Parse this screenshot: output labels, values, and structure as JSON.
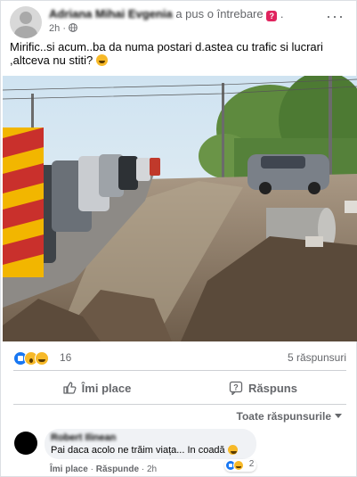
{
  "post": {
    "author": "Adriana Mihai Evgenia",
    "action": "a pus o întrebare",
    "question_icon": "?",
    "time": "2h",
    "separator": "·",
    "more_icon": "···",
    "text": "Mirific..si acum..ba da numa postari d.astea cu trafic si lucrari ,altceva nu stiti?",
    "text_emoji": "laughing-emoji-icon"
  },
  "reactions": {
    "count": "16",
    "comments": "5 răspunsuri",
    "icons": [
      "like-reaction-icon",
      "wow-reaction-icon",
      "haha-reaction-icon"
    ]
  },
  "actions": {
    "like_label": "Îmi place",
    "reply_label": "Răspuns"
  },
  "filter": {
    "label": "Toate răspunsurile"
  },
  "comment": {
    "author": "Robert Ilinean",
    "text": "Pai daca acolo ne trăim viața... In coadă",
    "emoji": "grinning-emoji-icon",
    "like_label": "Îmi place",
    "reply_label": "Răspunde",
    "time": "2h",
    "separator": "·",
    "reactions_count": "2"
  },
  "colors": {
    "accent": "#1877f2",
    "muted_text": "#65676b",
    "question_badge": "#e0245e"
  }
}
